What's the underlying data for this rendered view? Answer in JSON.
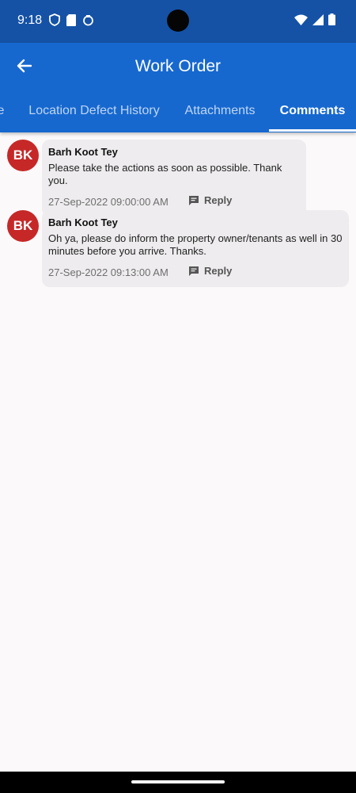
{
  "status_bar": {
    "time": "9:18",
    "icons_left": [
      "shield-icon",
      "sd-card-icon",
      "sync-icon"
    ],
    "icons_right": [
      "wifi-icon",
      "signal-icon",
      "battery-icon"
    ]
  },
  "app_bar": {
    "title": "Work Order",
    "back_icon": "arrow-left-icon",
    "color": "#1668cf"
  },
  "tabs": [
    {
      "label": "e",
      "active": false
    },
    {
      "label": "Location Defect History",
      "active": false
    },
    {
      "label": "Attachments",
      "active": false
    },
    {
      "label": "Comments",
      "active": true
    }
  ],
  "comments": [
    {
      "avatar_initials": "BK",
      "author": "Barh Koot Tey",
      "text": "Please take the actions as soon as possible. Thank you.",
      "timestamp": "27-Sep-2022 09:00:00 AM",
      "reply_label": "Reply"
    },
    {
      "avatar_initials": "BK",
      "author": "Barh Koot Tey",
      "text": "Oh ya, please do inform the property owner/tenants as well in 30 minutes before you arrive. Thanks.",
      "timestamp": "27-Sep-2022 09:13:00 AM",
      "reply_label": "Reply"
    }
  ],
  "colors": {
    "avatar": "#c62828",
    "status_bar": "#1552a6",
    "bubble": "#eeecee"
  }
}
